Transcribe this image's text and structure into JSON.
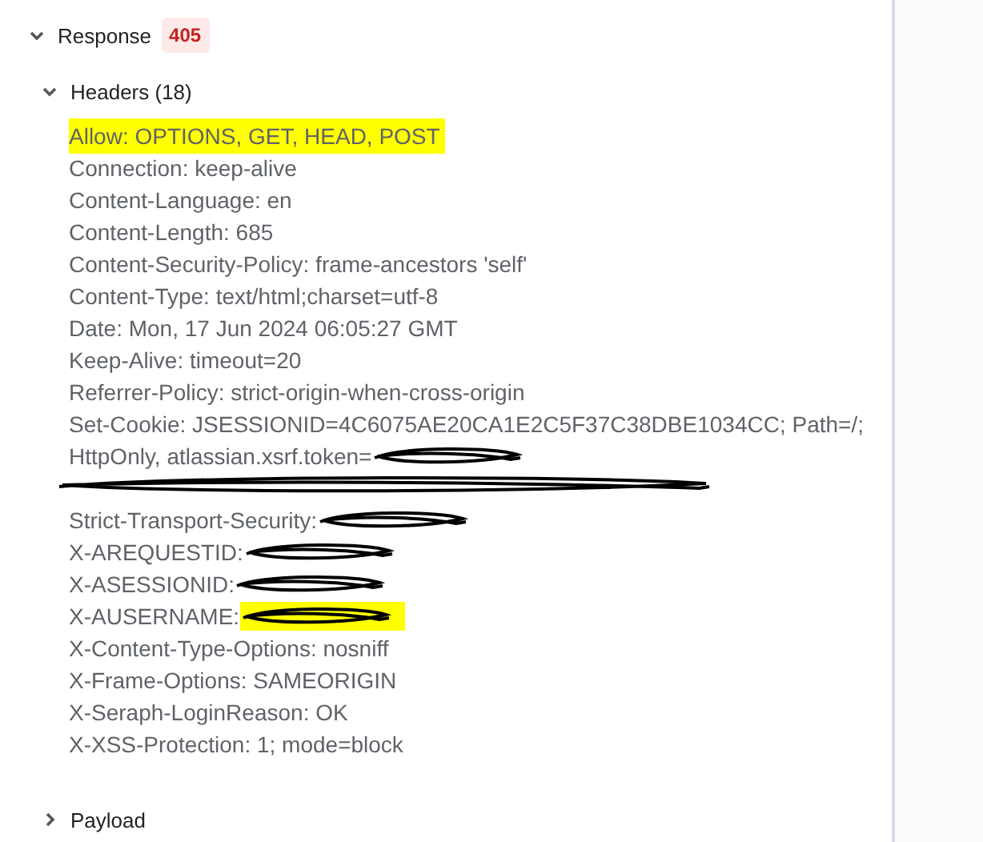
{
  "response": {
    "label": "Response",
    "status": "405",
    "expanded": true
  },
  "headers": {
    "label": "Headers (18)",
    "expanded": true,
    "lines": [
      {
        "kind": "line",
        "text": "Allow: OPTIONS, GET, HEAD, POST",
        "highlighted": true,
        "redacted": false
      },
      {
        "kind": "line",
        "text": "Connection: keep-alive",
        "highlighted": false,
        "redacted": false
      },
      {
        "kind": "line",
        "text": "Content-Language: en",
        "highlighted": false,
        "redacted": false
      },
      {
        "kind": "line",
        "text": "Content-Length: 685",
        "highlighted": false,
        "redacted": false
      },
      {
        "kind": "line",
        "text": "Content-Security-Policy: frame-ancestors 'self'",
        "highlighted": false,
        "redacted": false
      },
      {
        "kind": "line",
        "text": "Content-Type: text/html;charset=utf-8",
        "highlighted": false,
        "redacted": false
      },
      {
        "kind": "line",
        "text": "Date: Mon, 17 Jun 2024 06:05:27 GMT",
        "highlighted": false,
        "redacted": false
      },
      {
        "kind": "line",
        "text": "Keep-Alive: timeout=20",
        "highlighted": false,
        "redacted": false
      },
      {
        "kind": "line",
        "text": "Referrer-Policy: strict-origin-when-cross-origin",
        "highlighted": false,
        "redacted": false
      },
      {
        "kind": "line",
        "text": "Set-Cookie: JSESSIONID=4C6075AE20CA1E2C5F37C38DBE1034CC; Path=/;",
        "highlighted": false,
        "redacted": false
      },
      {
        "kind": "line",
        "text": "HttpOnly, atlassian.xsrf.token=",
        "highlighted": false,
        "redacted": true
      },
      {
        "kind": "blacked-out",
        "highlighted": false
      },
      {
        "kind": "line",
        "text": "Strict-Transport-Security:",
        "highlighted": false,
        "redacted": true
      },
      {
        "kind": "line",
        "text": "X-AREQUESTID:",
        "highlighted": false,
        "redacted": true
      },
      {
        "kind": "line",
        "text": "X-ASESSIONID:",
        "highlighted": false,
        "redacted": true
      },
      {
        "kind": "line",
        "text": "X-AUSERNAME:",
        "highlighted": true,
        "redacted": true
      },
      {
        "kind": "line",
        "text": "X-Content-Type-Options: nosniff",
        "highlighted": false,
        "redacted": false
      },
      {
        "kind": "line",
        "text": "X-Frame-Options: SAMEORIGIN",
        "highlighted": false,
        "redacted": false
      },
      {
        "kind": "line",
        "text": "X-Seraph-LoginReason: OK",
        "highlighted": false,
        "redacted": false
      },
      {
        "kind": "line",
        "text": "X-XSS-Protection: 1; mode=block",
        "highlighted": false,
        "redacted": false
      }
    ]
  },
  "payload": {
    "label": "Payload",
    "expanded": false
  }
}
